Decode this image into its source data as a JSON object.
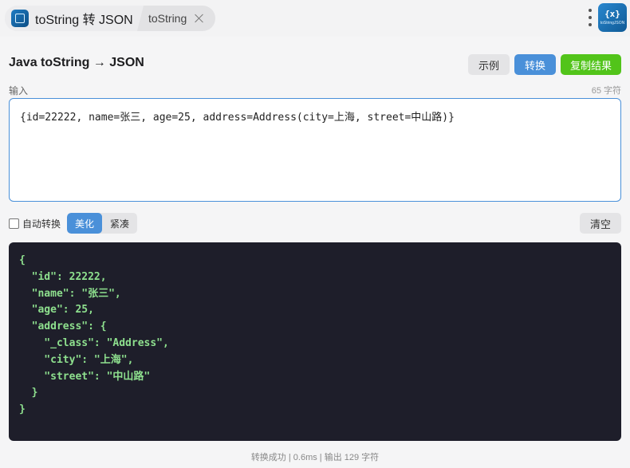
{
  "tabs": {
    "active_title": "toString 转 JSON",
    "second_label": "toString"
  },
  "icons": {
    "app_icon_glyph": "{x}",
    "app_icon_caption": "toStringJSON"
  },
  "header": {
    "title": "Java toString → JSON",
    "example_label": "示例",
    "convert_label": "转换",
    "copy_label": "复制结果"
  },
  "input": {
    "label": "输入",
    "char_count": "65 字符",
    "value": "{id=22222, name=张三, age=25, address=Address(city=上海, street=中山路)}"
  },
  "options": {
    "auto_convert_label": "自动转换",
    "auto_convert_checked": false,
    "format_beautify": "美化",
    "format_compact": "紧凑",
    "selected_format": "美化",
    "clear_label": "清空"
  },
  "output": {
    "text": "{\n  \"id\": 22222,\n  \"name\": \"张三\",\n  \"age\": 25,\n  \"address\": {\n    \"_class\": \"Address\",\n    \"city\": \"上海\",\n    \"street\": \"中山路\"\n  }\n}"
  },
  "status": {
    "text": "转换成功 | 0.6ms | 输出 129 字符"
  },
  "colors": {
    "accent": "#4a90d9",
    "success": "#52c41a",
    "code_bg": "#1e1e2a",
    "code_text": "#8ee08e"
  }
}
